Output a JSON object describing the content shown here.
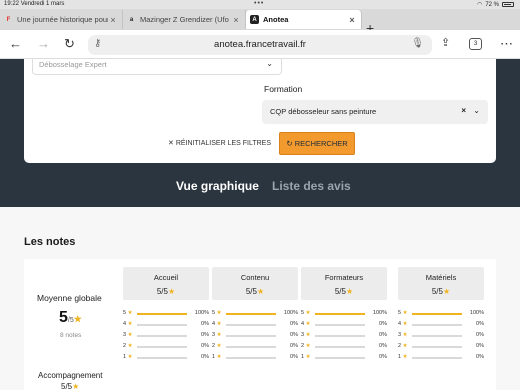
{
  "status": {
    "time": "19:22",
    "date": "Vendredi 1 mars",
    "battery": "72 %"
  },
  "tabs": [
    {
      "title": "Une journée historique pour",
      "favicon": "F",
      "active": false
    },
    {
      "title": "Mazinger Z Grendizer (Ufo",
      "favicon": "a",
      "active": false
    },
    {
      "title": "Anotea",
      "favicon": "A",
      "active": true
    }
  ],
  "address": {
    "url": "anotea.francetravail.fr",
    "tab_count": "3"
  },
  "filters": {
    "first_select": "Débosselage Expert",
    "formation_label": "Formation",
    "formation_value": "CQP débosseleur sans peinture",
    "reset_label": "RÉINITIALISER LES FILTRES",
    "search_label": "RECHERCHER"
  },
  "views": {
    "graph": "Vue graphique",
    "list": "Liste des avis"
  },
  "notes": {
    "title": "Les notes",
    "average_label": "Moyenne globale",
    "average_value": "5",
    "average_scale": "/5",
    "count": "8 notes",
    "accompagnement_label": "Accompagnement",
    "accompagnement_value": "5/5",
    "criteria": [
      {
        "label": "Accueil",
        "value": "5/5",
        "distribution": [
          {
            "level": "5",
            "pct": "100%",
            "frac": 1
          },
          {
            "level": "4",
            "pct": "0%",
            "frac": 0
          },
          {
            "level": "3",
            "pct": "0%",
            "frac": 0
          },
          {
            "level": "2",
            "pct": "0%",
            "frac": 0
          },
          {
            "level": "1",
            "pct": "0%",
            "frac": 0
          }
        ]
      },
      {
        "label": "Contenu",
        "value": "5/5",
        "distribution": [
          {
            "level": "5",
            "pct": "100%",
            "frac": 1
          },
          {
            "level": "4",
            "pct": "0%",
            "frac": 0
          },
          {
            "level": "3",
            "pct": "0%",
            "frac": 0
          },
          {
            "level": "2",
            "pct": "0%",
            "frac": 0
          },
          {
            "level": "1",
            "pct": "0%",
            "frac": 0
          }
        ]
      },
      {
        "label": "Formateurs",
        "value": "5/5",
        "distribution": [
          {
            "level": "5",
            "pct": "100%",
            "frac": 1
          },
          {
            "level": "4",
            "pct": "0%",
            "frac": 0
          },
          {
            "level": "3",
            "pct": "0%",
            "frac": 0
          },
          {
            "level": "2",
            "pct": "0%",
            "frac": 0
          },
          {
            "level": "1",
            "pct": "0%",
            "frac": 0
          }
        ]
      },
      {
        "label": "Matériels",
        "value": "5/5",
        "distribution": [
          {
            "level": "5",
            "pct": "100%",
            "frac": 1
          },
          {
            "level": "4",
            "pct": "0%",
            "frac": 0
          },
          {
            "level": "3",
            "pct": "0%",
            "frac": 0
          },
          {
            "level": "2",
            "pct": "0%",
            "frac": 0
          },
          {
            "level": "1",
            "pct": "0%",
            "frac": 0
          }
        ]
      }
    ]
  },
  "colors": {
    "hero": "#2b353f",
    "accent": "#f39a2e",
    "star": "#f2b321"
  }
}
